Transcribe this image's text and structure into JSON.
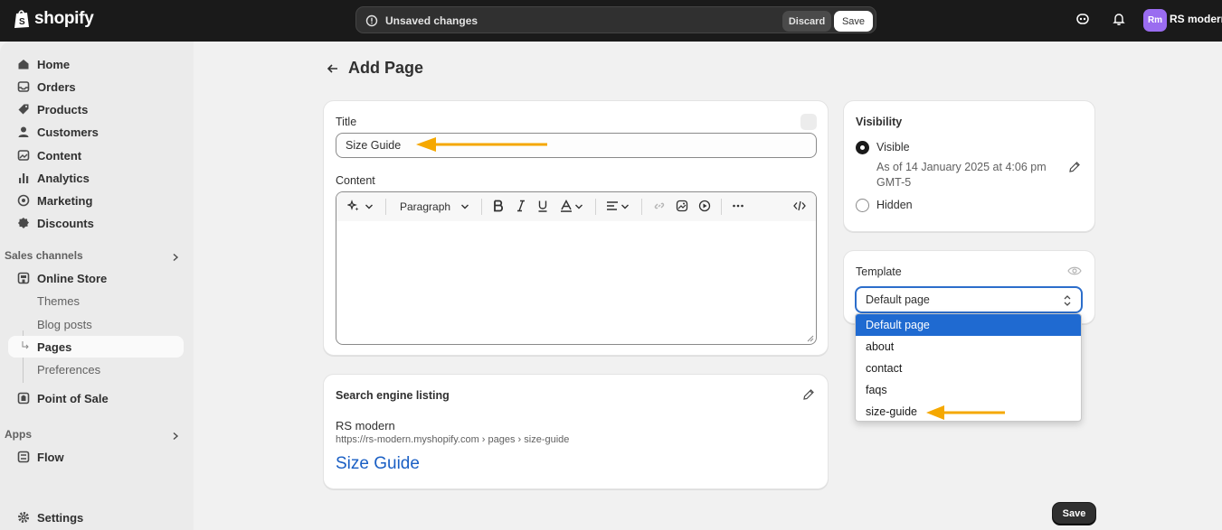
{
  "brand": {
    "name": "shopify"
  },
  "topbar": {
    "unsaved_text": "Unsaved changes",
    "discard_label": "Discard",
    "save_label": "Save",
    "avatar_initials": "Rm",
    "store_name": "RS modern"
  },
  "sidebar": {
    "main_items": [
      {
        "label": "Home",
        "icon": "home-icon"
      },
      {
        "label": "Orders",
        "icon": "inbox-icon"
      },
      {
        "label": "Products",
        "icon": "tag-icon"
      },
      {
        "label": "Customers",
        "icon": "person-icon"
      },
      {
        "label": "Content",
        "icon": "image-icon"
      },
      {
        "label": "Analytics",
        "icon": "bar-chart-icon"
      },
      {
        "label": "Marketing",
        "icon": "target-icon"
      },
      {
        "label": "Discounts",
        "icon": "discount-icon"
      }
    ],
    "sales_channels_label": "Sales channels",
    "online_store": "Online Store",
    "sub_items": [
      "Themes",
      "Blog posts",
      "Pages",
      "Preferences"
    ],
    "point_of_sale": "Point of Sale",
    "apps_label": "Apps",
    "flow": "Flow",
    "settings": "Settings"
  },
  "page": {
    "title": "Add Page"
  },
  "form": {
    "title_label": "Title",
    "title_value": "Size Guide",
    "content_label": "Content",
    "paragraph_label": "Paragraph"
  },
  "seo": {
    "heading": "Search engine listing",
    "store": "RS modern",
    "url": "https://rs-modern.myshopify.com › pages › size-guide",
    "link_title": "Size Guide"
  },
  "visibility": {
    "heading": "Visibility",
    "visible_label": "Visible",
    "visible_detail": "As of 14 January 2025 at 4:06 pm GMT-5",
    "hidden_label": "Hidden"
  },
  "template": {
    "heading": "Template",
    "selected": "Default page",
    "options": [
      "Default page",
      "about",
      "contact",
      "faqs",
      "size-guide"
    ]
  },
  "footer": {
    "save_label": "Save"
  },
  "colors": {
    "annotation_arrow": "#f5a800",
    "accent": "#1f6ad1"
  }
}
